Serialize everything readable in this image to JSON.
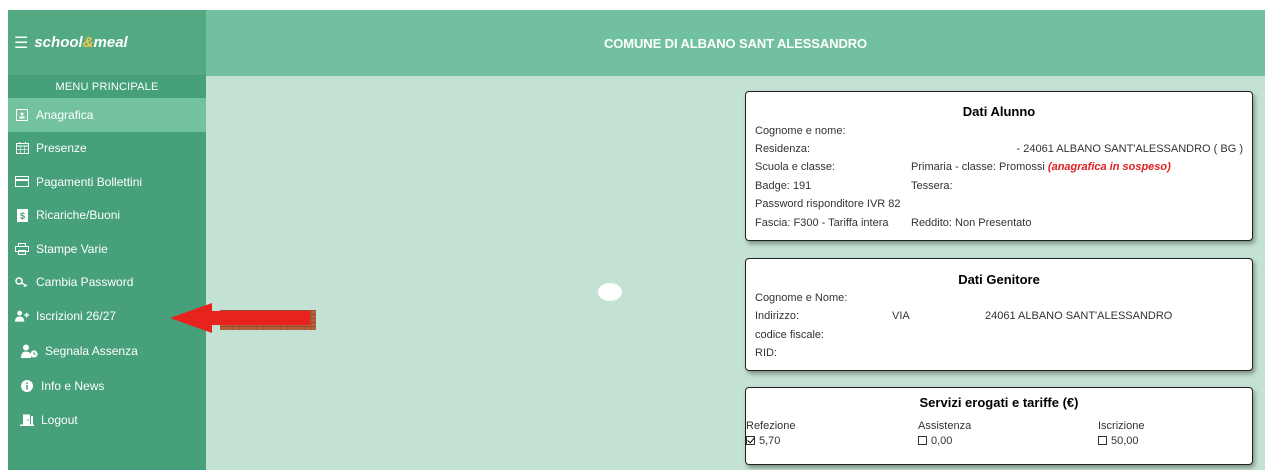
{
  "brand": {
    "logo_pre": "school",
    "logo_amp": "&",
    "logo_post": "meal"
  },
  "header": {
    "title": "COMUNE DI ALBANO SANT ALESSANDRO"
  },
  "sidebar": {
    "menu_header": "MENU PRINCIPALE",
    "items": [
      {
        "label": "Anagrafica",
        "icon": "id-card-icon"
      },
      {
        "label": "Presenze",
        "icon": "calendar-icon"
      },
      {
        "label": "Pagamenti Bollettini",
        "icon": "credit-card-icon"
      },
      {
        "label": "Ricariche/Buoni",
        "icon": "voucher-icon"
      },
      {
        "label": "Stampe Varie",
        "icon": "printer-icon"
      },
      {
        "label": "Cambia Password",
        "icon": "key-icon"
      },
      {
        "label": "Iscrizioni 26/27",
        "icon": "user-plus-icon"
      },
      {
        "label": "Segnala Assenza",
        "icon": "user-clock-icon"
      },
      {
        "label": "Info e News",
        "icon": "info-icon"
      },
      {
        "label": "Logout",
        "icon": "door-exit-icon"
      }
    ]
  },
  "alunno": {
    "title": "Dati Alunno",
    "cognome_label": "Cognome e nome:",
    "residenza_label": "Residenza:",
    "residenza_value": "- 24061 ALBANO SANT'ALESSANDRO ( BG )",
    "scuola_label": "Scuola e classe:",
    "scuola_value": "Primaria - classe: Promossi",
    "scuola_note": "(anagrafica in sospeso)",
    "badge_label": "Badge:",
    "badge_value": "191",
    "tessera_label": "Tessera:",
    "password_label": "Password risponditore IVR",
    "password_value": "82",
    "fascia_text": "Fascia: F300 - Tariffa intera",
    "reddito_text": "Reddito: Non Presentato"
  },
  "genitore": {
    "title": "Dati Genitore",
    "cognome_label": "Cognome e Nome:",
    "indirizzo_label": "Indirizzo:",
    "indirizzo_via": "VIA",
    "indirizzo_value": "24061 ALBANO SANT'ALESSANDRO",
    "cf_label": "codice fiscale:",
    "rid_label": "RID:"
  },
  "servizi": {
    "title": "Servizi erogati e tariffe (€)",
    "items": [
      {
        "label": "Refezione",
        "value": "5,70",
        "checked": true
      },
      {
        "label": "Assistenza",
        "value": "0,00",
        "checked": false
      },
      {
        "label": "Iscrizione",
        "value": "50,00",
        "checked": false
      }
    ]
  },
  "colors": {
    "sidebar": "#46a07a",
    "header": "#71c0a0",
    "active_item": "#72c29d",
    "content_bg": "#c4e2d3",
    "arrow": "#e8231e"
  }
}
